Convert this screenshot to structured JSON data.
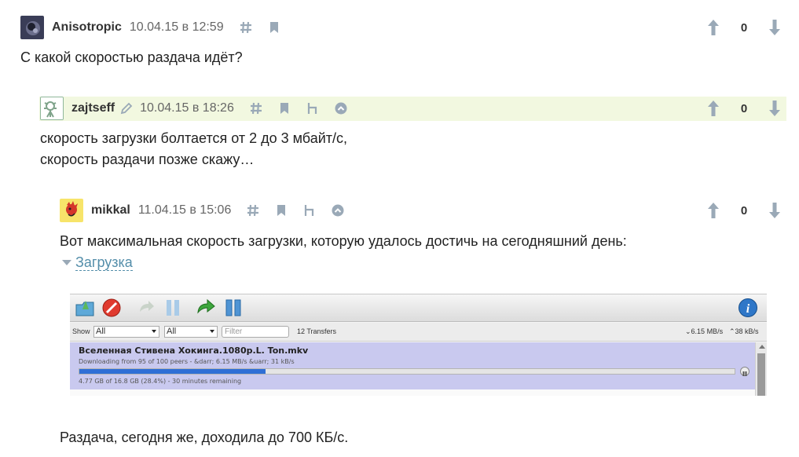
{
  "comments": [
    {
      "username": "Anisotropic",
      "timestamp": "10.04.15 в 12:59",
      "score": "0",
      "text_lines": [
        "С какой скоростью раздача идёт?"
      ]
    },
    {
      "username": "zajtseff",
      "timestamp": "10.04.15 в 18:26",
      "score": "0",
      "text_lines": [
        "скорость загрузки болтается от 2 до 3 мбайт/с,",
        "скорость раздачи позже скажу…"
      ]
    },
    {
      "username": "mikkal",
      "timestamp": "11.04.15 в 15:06",
      "score": "0",
      "text_lines": [
        "Вот максимальная скорость загрузки, которую удалось достичь на сегодняшний день:"
      ],
      "spoiler_label": "Загрузка",
      "after_text": "Раздача, сегодня же, доходила до 700 КБ/с."
    }
  ],
  "torrent_screenshot": {
    "show_label": "Show",
    "filter1": "All",
    "filter2": "All",
    "filter_placeholder": "Filter",
    "transfers": "12 Transfers",
    "down_rate": "6.15 MB/s",
    "up_rate": "38 kB/s",
    "file_name": "Вселенная Стивена Хокинга.1080p.L. Ton.mkv",
    "status": "Downloading from 95 of 100 peers - &darr; 6.15 MB/s &uarr; 31 kB/s",
    "progress_text": "4.77 GB of 16.8 GB (28.4%) - 30 minutes remaining",
    "progress": 0.284
  },
  "colors": {
    "icon": "#9aa9b7",
    "highlight_row": "#f2f8e0",
    "link": "#548eaa"
  },
  "icons": [
    "hash-icon",
    "bookmark-icon",
    "parent-link-icon",
    "collapse-icon",
    "edit-icon",
    "upvote-icon",
    "downvote-icon"
  ]
}
